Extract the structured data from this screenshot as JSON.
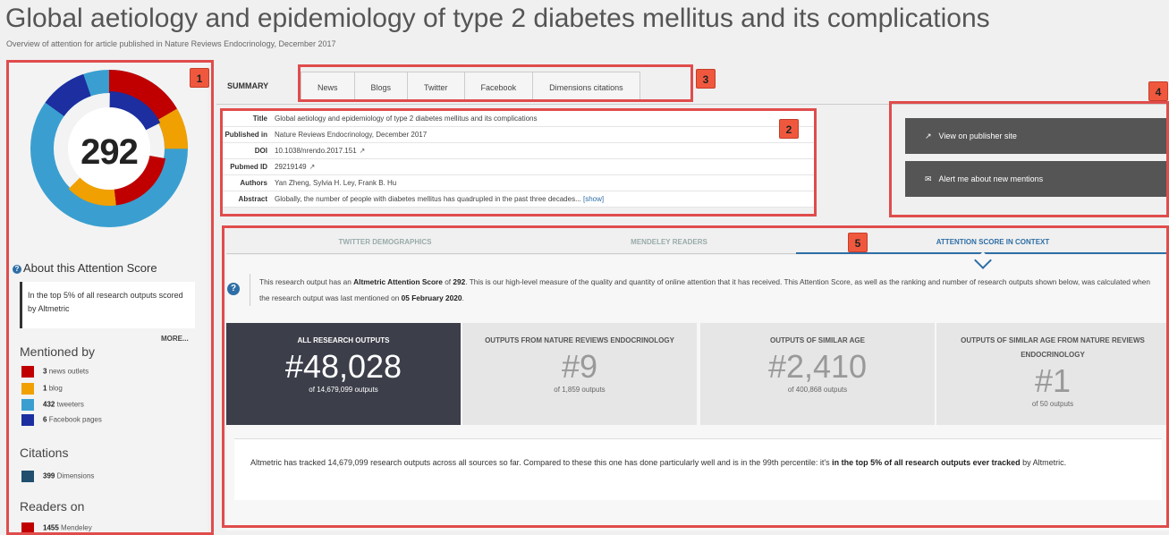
{
  "page": {
    "title": "Global aetiology and epidemiology of type 2 diabetes mellitus and its complications",
    "subtitle": "Overview of attention for article published in Nature Reviews Endocrinology, December 2017"
  },
  "callouts": [
    "1",
    "2",
    "3",
    "4",
    "5"
  ],
  "sidebar": {
    "score": "292",
    "about_label": "About this Attention Score",
    "top_text": "In the top 5% of all research outputs scored by Altmetric",
    "more_label": "MORE...",
    "mentioned_by_heading": "Mentioned by",
    "mentions": [
      {
        "count": "3",
        "label": "news outlets",
        "color": "#c00000"
      },
      {
        "count": "1",
        "label": "blog",
        "color": "#f0a000"
      },
      {
        "count": "432",
        "label": "tweeters",
        "color": "#3a9fd0"
      },
      {
        "count": "6",
        "label": "Facebook pages",
        "color": "#1c2ea0"
      }
    ],
    "citations_heading": "Citations",
    "citations": [
      {
        "count": "399",
        "label": "Dimensions",
        "color": "#1f4e6e"
      }
    ],
    "readers_heading": "Readers on",
    "readers": [
      {
        "count": "1455",
        "label": "Mendeley",
        "color": "#c00000"
      }
    ]
  },
  "tabs": {
    "summary_label": "SUMMARY",
    "items": [
      "News",
      "Blogs",
      "Twitter",
      "Facebook",
      "Dimensions citations"
    ]
  },
  "info": {
    "title_key": "Title",
    "title_val": "Global aetiology and epidemiology of type 2 diabetes mellitus and its complications",
    "published_key": "Published in",
    "published_val": "Nature Reviews Endocrinology, December 2017",
    "doi_key": "DOI",
    "doi_val": "10.1038/nrendo.2017.151",
    "pubmed_key": "Pubmed ID",
    "pubmed_val": "29219149",
    "authors_key": "Authors",
    "authors_val": "Yan Zheng, Sylvia H. Ley, Frank B. Hu",
    "abstract_key": "Abstract",
    "abstract_val": "Globally, the number of people with diabetes mellitus has quadrupled in the past three decades...",
    "show_label": "[show]"
  },
  "actions": {
    "publisher_label": "View on publisher site",
    "alert_label": "Alert me about new mentions"
  },
  "context": {
    "tab_twitter": "TWITTER DEMOGRAPHICS",
    "tab_mendeley": "MENDELEY READERS",
    "tab_attention": "ATTENTION SCORE IN CONTEXT",
    "intro_a": "This research output has an ",
    "intro_b": "Altmetric Attention Score",
    "intro_c": " of ",
    "intro_d": "292",
    "intro_e": ". This is our high-level measure of the quality and quantity of online attention that it has received. This Attention Score, as well as the ranking and number of research outputs shown below, was calculated when the research output was last mentioned on ",
    "intro_f": "05 February 2020",
    "intro_g": ".",
    "ranks": [
      {
        "heading": "ALL RESEARCH OUTPUTS",
        "value": "#48,028",
        "sub": "of 14,679,099 outputs"
      },
      {
        "heading": "OUTPUTS FROM NATURE REVIEWS ENDOCRINOLOGY",
        "value": "#9",
        "sub": "of 1,859 outputs"
      },
      {
        "heading": "OUTPUTS OF SIMILAR AGE",
        "value": "#2,410",
        "sub": "of 400,868 outputs"
      },
      {
        "heading": "OUTPUTS OF SIMILAR AGE FROM NATURE REVIEWS ENDOCRINOLOGY",
        "value": "#1",
        "sub": "of 50 outputs"
      }
    ],
    "summary_a": "Altmetric has tracked 14,679,099 research outputs across all sources so far. Compared to these this one has done particularly well and is in the 99th percentile: it's ",
    "summary_b": "in the top 5% of all research outputs ever tracked",
    "summary_c": " by Altmetric."
  }
}
